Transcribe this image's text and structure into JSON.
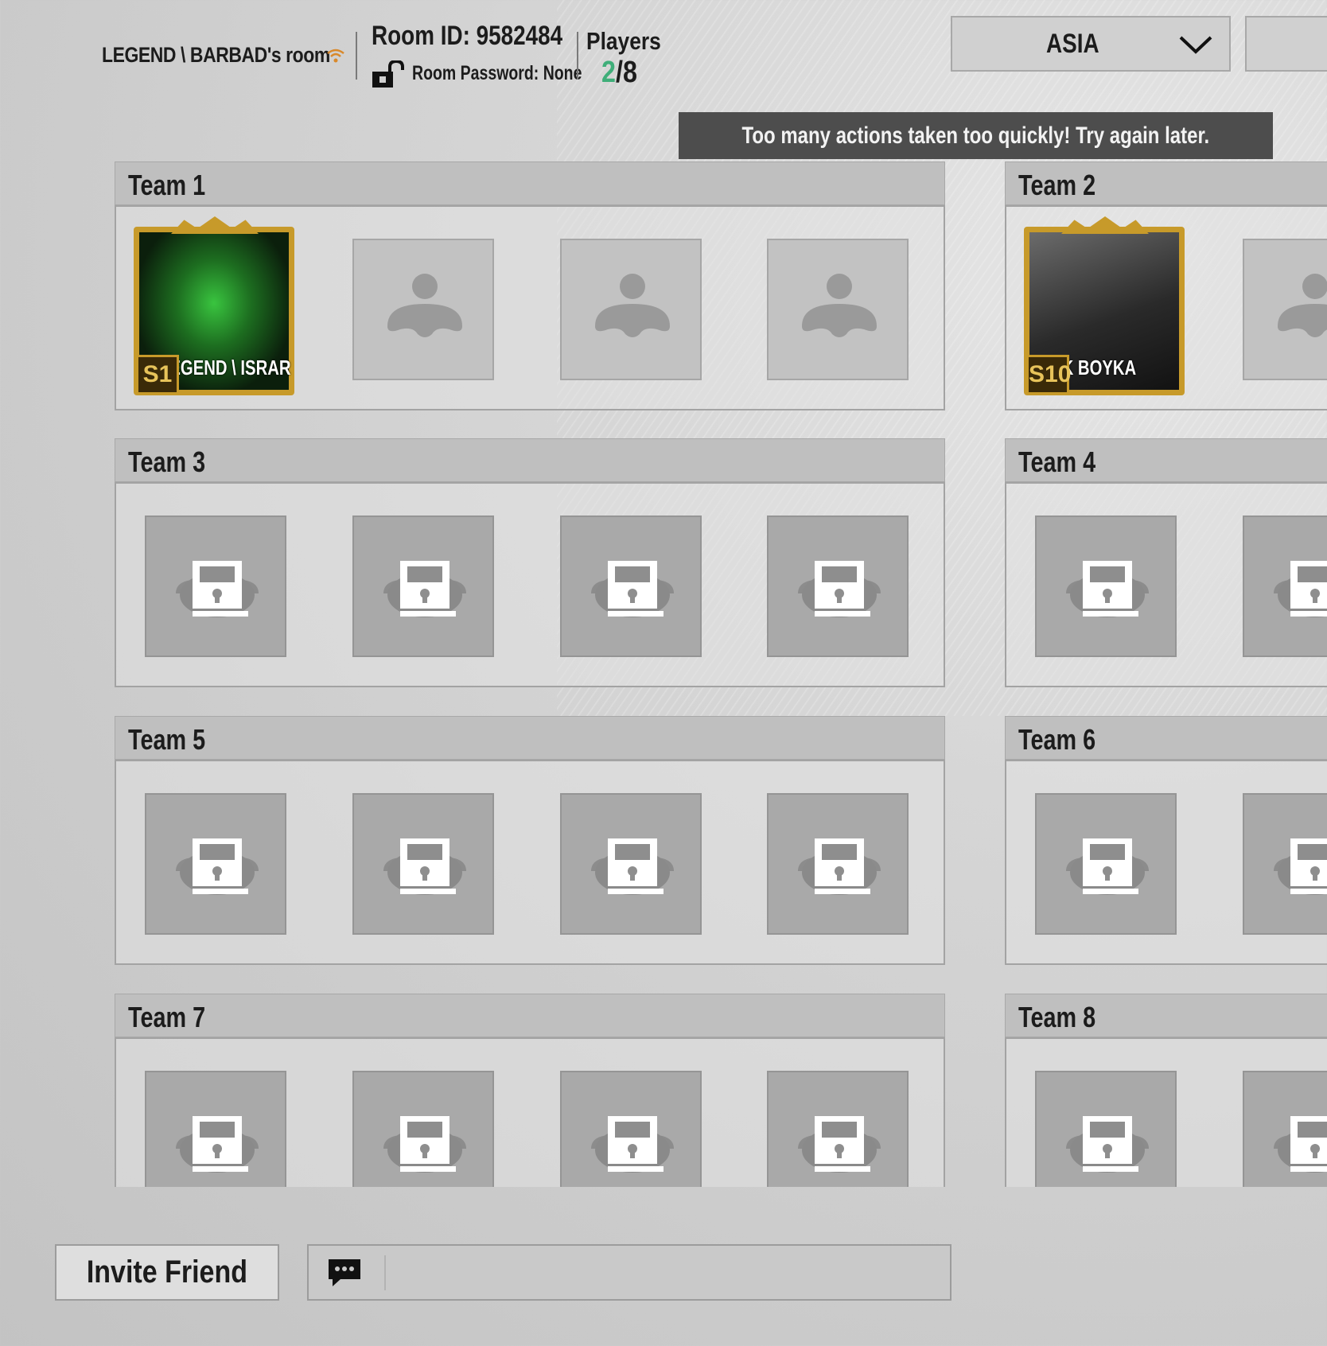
{
  "header": {
    "room_owner": "LEGEND \\ BARBAD's room",
    "room_id": "Room ID: 9582484",
    "room_password": "Room Password: None",
    "players_label": "Players",
    "players_current": "2",
    "players_max": "/8",
    "region": "ASIA"
  },
  "toast": "Too many actions taken too quickly! Try again later.",
  "teams": [
    {
      "label": "Team 1"
    },
    {
      "label": "Team 2"
    },
    {
      "label": "Team 3"
    },
    {
      "label": "Team 4"
    },
    {
      "label": "Team 5"
    },
    {
      "label": "Team 6"
    },
    {
      "label": "Team 7"
    },
    {
      "label": "Team 8"
    }
  ],
  "players": [
    {
      "name": "LEGEND \\ ISRAR",
      "badge": "S1"
    },
    {
      "name": "UK BOYKA",
      "badge": "S10"
    }
  ],
  "footer": {
    "invite_label": "Invite Friend"
  },
  "colors": {
    "accent_green": "#3fae79",
    "frame_gold": "#c79a2a",
    "toast_bg": "#4d4d4d"
  },
  "icons": [
    "wifi-icon",
    "lock-open-icon",
    "chevron-down-icon",
    "person-silhouette-icon",
    "lock-icon",
    "chat-icon"
  ]
}
